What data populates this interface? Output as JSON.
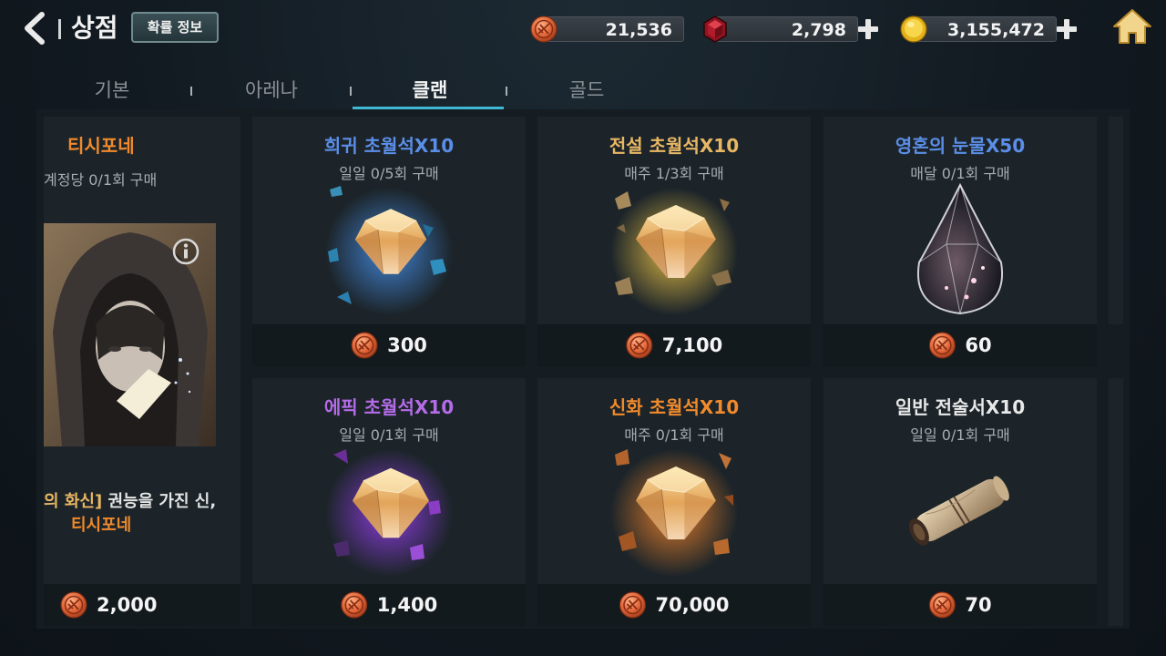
{
  "header": {
    "title": "상점",
    "probability_button": "확률 정보",
    "currencies": [
      {
        "icon": "clan-coin-icon",
        "value": "21,536",
        "has_plus": false
      },
      {
        "icon": "red-gem-icon",
        "value": "2,798",
        "has_plus": true
      },
      {
        "icon": "gold-coin-icon",
        "value": "3,155,472",
        "has_plus": true
      }
    ]
  },
  "tabs": [
    {
      "label": "기본",
      "active": false
    },
    {
      "label": "아레나",
      "active": false
    },
    {
      "label": "클랜",
      "active": true
    },
    {
      "label": "골드",
      "active": false
    }
  ],
  "hero_card": {
    "name": "티시포네",
    "limit": "계정당 0/1회 구매",
    "desc_bracket": "의 화신]",
    "desc_text": " 권능을 가진 신,",
    "desc_name": "티시포네",
    "price": "2,000"
  },
  "items": [
    {
      "name": "희귀 초월석X10",
      "grade": "rare",
      "limit": "일일 0/5회 구매",
      "price": "300",
      "art": "rare-crystal-icon"
    },
    {
      "name": "전설 초월석X10",
      "grade": "legend",
      "limit": "매주 1/3회 구매",
      "price": "7,100",
      "art": "legend-crystal-icon"
    },
    {
      "name": "영혼의 눈물X50",
      "grade": "rare",
      "limit": "매달 0/1회 구매",
      "price": "60",
      "art": "soul-tear-icon"
    },
    {
      "name": "에픽 초월석X10",
      "grade": "epic",
      "limit": "일일 0/1회 구매",
      "price": "1,400",
      "art": "epic-crystal-icon"
    },
    {
      "name": "신화 초월석X10",
      "grade": "myth",
      "limit": "매주 0/1회 구매",
      "price": "70,000",
      "art": "myth-crystal-icon"
    },
    {
      "name": "일반 전술서X10",
      "grade": "normal",
      "limit": "일일 0/1회 구매",
      "price": "70",
      "art": "scroll-icon"
    }
  ],
  "colors": {
    "rare": "#5b8ee8",
    "legend": "#e8b764",
    "epic": "#b46be8",
    "myth": "#f08a2c",
    "tab_active_underline": "#3fb8d6"
  }
}
